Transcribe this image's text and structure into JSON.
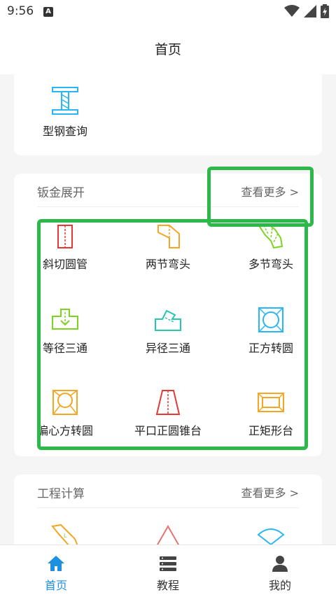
{
  "status_bar": {
    "time": "9:56",
    "notification_icon": "A"
  },
  "header": {
    "title": "首页"
  },
  "top_card": {
    "item_label": "型钢查询",
    "item_icon": "steel-beam-icon"
  },
  "sheet_metal": {
    "title": "钣金展开",
    "more": "查看更多 >",
    "items": [
      {
        "label": "斜切圆管",
        "icon": "oblique-cut-pipe-icon",
        "color": "#e53935"
      },
      {
        "label": "两节弯头",
        "icon": "two-section-elbow-icon",
        "color": "#f5a623"
      },
      {
        "label": "多节弯头",
        "icon": "multi-section-elbow-icon",
        "color": "#7ed321"
      },
      {
        "label": "等径三通",
        "icon": "equal-tee-icon",
        "color": "#7ed321"
      },
      {
        "label": "异径三通",
        "icon": "reducing-tee-icon",
        "color": "#26c6b0"
      },
      {
        "label": "正方转圆",
        "icon": "square-to-round-icon",
        "color": "#29b6f6"
      },
      {
        "label": "偏心方转圆",
        "icon": "eccentric-square-to-round-icon",
        "color": "#f5a623"
      },
      {
        "label": "平口正圆锥台",
        "icon": "flat-cone-frustum-icon",
        "color": "#e53935"
      },
      {
        "label": "正矩形台",
        "icon": "rectangular-frustum-icon",
        "color": "#f5a623"
      }
    ]
  },
  "engineering": {
    "title": "工程计算",
    "more": "查看更多 >",
    "items": [
      {
        "icon": "slope-calc-icon",
        "color": "#f5a623"
      },
      {
        "icon": "triangle-calc-icon",
        "color": "#e57373"
      },
      {
        "icon": "arc-calc-icon",
        "color": "#29b6f6"
      }
    ]
  },
  "bottom_nav": [
    {
      "label": "首页",
      "icon": "home-icon",
      "active": true
    },
    {
      "label": "教程",
      "icon": "tutorial-icon",
      "active": false
    },
    {
      "label": "我的",
      "icon": "profile-icon",
      "active": false
    }
  ],
  "colors": {
    "accent": "#1e90e0",
    "highlight": "#2db84a"
  }
}
